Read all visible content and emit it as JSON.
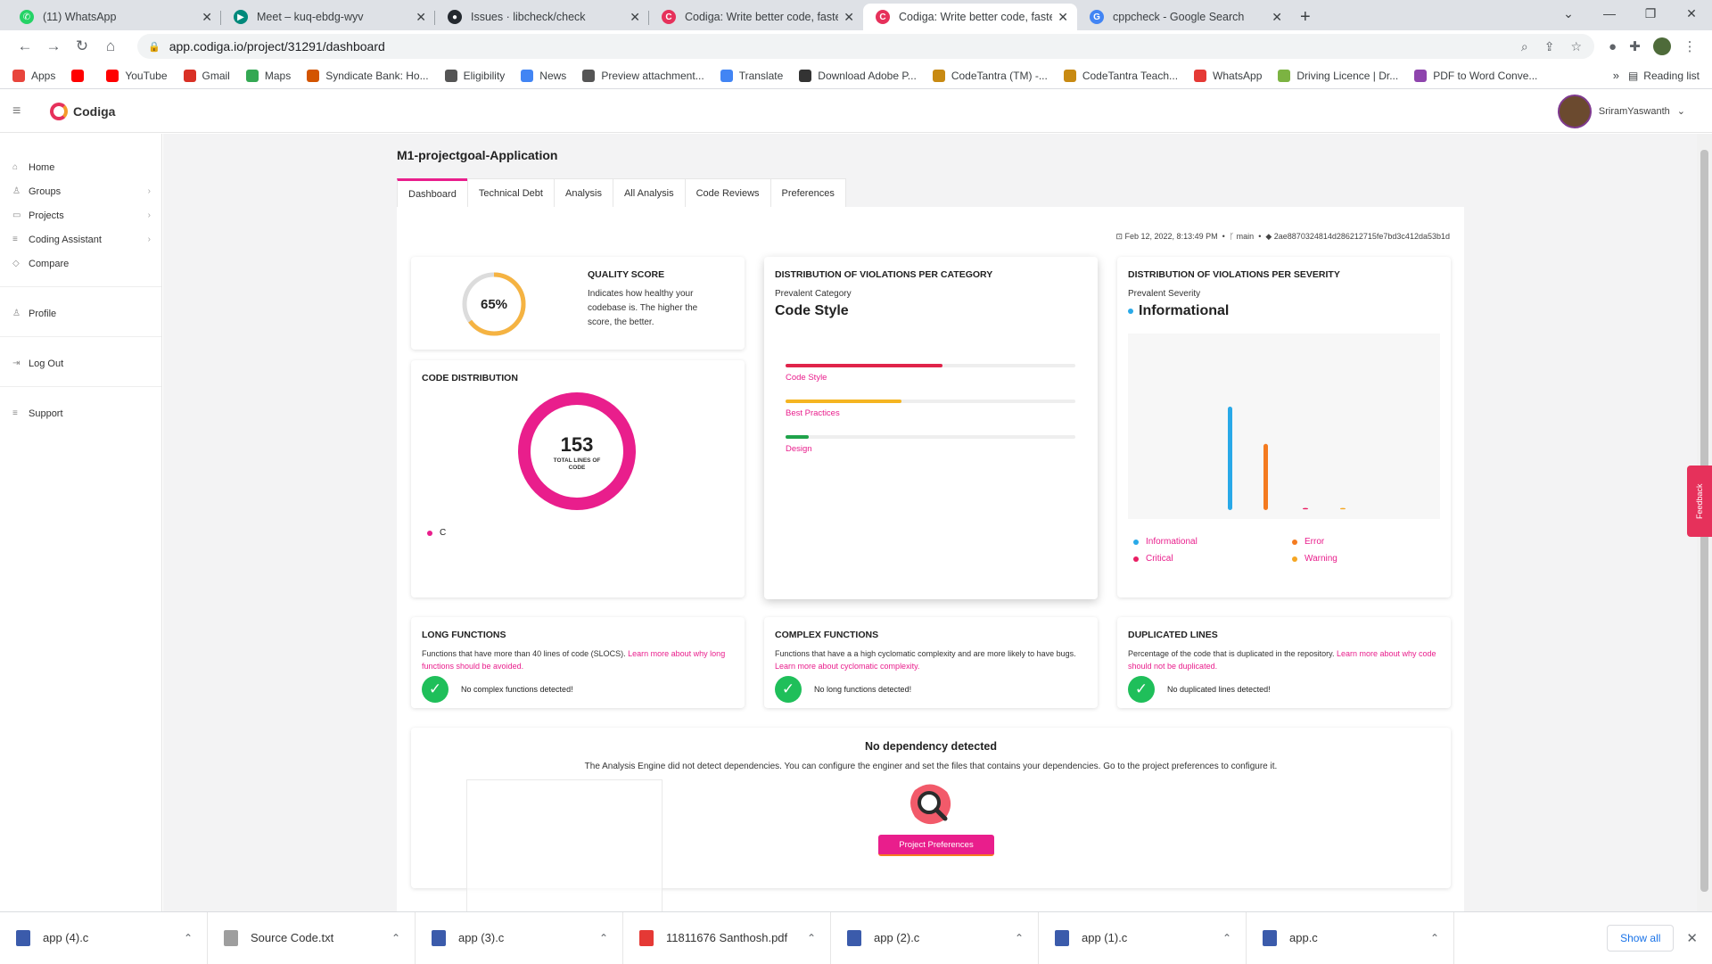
{
  "browser": {
    "tabs": [
      {
        "title": "(11) WhatsApp",
        "color": "#25d366",
        "glyph": "✆"
      },
      {
        "title": "Meet – kuq-ebdg-wyv",
        "color": "#00897b",
        "glyph": "▶"
      },
      {
        "title": "Issues · libcheck/check",
        "color": "#24292f",
        "glyph": "●"
      },
      {
        "title": "Codiga: Write better code, faster!",
        "color": "#e6315b",
        "glyph": "C"
      },
      {
        "title": "Codiga: Write better code, faster!",
        "color": "#e6315b",
        "glyph": "C",
        "active": true
      },
      {
        "title": "cppcheck - Google Search",
        "color": "#4285f4",
        "glyph": "G"
      }
    ],
    "url": "app.codiga.io/project/31291/dashboard",
    "bookmarks": [
      {
        "label": "Apps",
        "color": "#e8453c"
      },
      {
        "label": "",
        "color": "#ff0000"
      },
      {
        "label": "YouTube",
        "color": "#ff0000"
      },
      {
        "label": "Gmail",
        "color": "#d93025"
      },
      {
        "label": "Maps",
        "color": "#34a853"
      },
      {
        "label": "Syndicate Bank: Ho...",
        "color": "#d35400"
      },
      {
        "label": "Eligibility",
        "color": "#555555"
      },
      {
        "label": "News",
        "color": "#4285f4"
      },
      {
        "label": "Preview attachment...",
        "color": "#555555"
      },
      {
        "label": "Translate",
        "color": "#4285f4"
      },
      {
        "label": "Download Adobe P...",
        "color": "#333333"
      },
      {
        "label": "CodeTantra (TM) -...",
        "color": "#c88a12"
      },
      {
        "label": "CodeTantra Teach...",
        "color": "#c88a12"
      },
      {
        "label": "WhatsApp",
        "color": "#e53935"
      },
      {
        "label": "Driving Licence | Dr...",
        "color": "#7cb342"
      },
      {
        "label": "PDF to Word Conve...",
        "color": "#8e44ad"
      }
    ],
    "reading_list": "Reading list"
  },
  "app": {
    "brand": "Codiga",
    "user": "SriramYaswanth",
    "sidebar": {
      "main": [
        {
          "label": "Home",
          "icon": "home-icon",
          "glyph": "⌂"
        },
        {
          "label": "Groups",
          "icon": "groups-icon",
          "glyph": "♙",
          "chevron": true
        },
        {
          "label": "Projects",
          "icon": "projects-icon",
          "glyph": "▭",
          "chevron": true
        },
        {
          "label": "Coding Assistant",
          "icon": "assistant-icon",
          "glyph": "≡",
          "chevron": true
        },
        {
          "label": "Compare",
          "icon": "compare-icon",
          "glyph": "◇"
        }
      ],
      "profile": "Profile",
      "logout": "Log Out",
      "support": "Support"
    },
    "project_title": "M1-projectgoal-Application",
    "tabs": [
      "Dashboard",
      "Technical Debt",
      "Analysis",
      "All Analysis",
      "Code Reviews",
      "Preferences"
    ],
    "meta": {
      "date": "Feb 12, 2022, 8:13:49 PM",
      "branch": "main",
      "commit": "2ae8870324814d286212715fe7bd3c412da53b1d"
    },
    "quality": {
      "title": "QUALITY SCORE",
      "score_label": "65%",
      "score": 0.65,
      "desc": "Indicates how healthy your codebase is. The higher the score, the better."
    },
    "code_distribution": {
      "title": "CODE DISTRIBUTION",
      "total": "153",
      "total_label": "TOTAL LINES OF CODE",
      "legend": "C"
    },
    "category": {
      "title": "DISTRIBUTION OF VIOLATIONS PER CATEGORY",
      "prevalent_label": "Prevalent Category",
      "prevalent": "Code Style",
      "bars": [
        {
          "label": "Code Style",
          "value": 0.54,
          "color": "#e0234a"
        },
        {
          "label": "Best Practices",
          "value": 0.4,
          "color": "#f5b521"
        },
        {
          "label": "Design",
          "value": 0.08,
          "color": "#1fa34a"
        }
      ]
    },
    "severity": {
      "title": "DISTRIBUTION OF VIOLATIONS PER SEVERITY",
      "prevalent_label": "Prevalent Severity",
      "prevalent": "Informational",
      "bars": [
        {
          "label": "Informational",
          "value": 1.0,
          "color": "#29a9e8"
        },
        {
          "label": "Error",
          "value": 0.64,
          "color": "#f47b20"
        },
        {
          "label": "Critical",
          "value": 0.02,
          "color": "#e91e63"
        },
        {
          "label": "Warning",
          "value": 0.02,
          "color": "#f5a623"
        }
      ]
    },
    "long_functions": {
      "title": "LONG FUNCTIONS",
      "desc": "Functions that have more than 40 lines of code (SLOCS). ",
      "link": "Learn more about why long functions should be avoided.",
      "status": "No complex functions detected!"
    },
    "complex_functions": {
      "title": "COMPLEX FUNCTIONS",
      "desc": "Functions that have a a high cyclomatic complexity and are more likely to have bugs. ",
      "link": "Learn more about cyclomatic complexity.",
      "status": "No long functions detected!"
    },
    "duplicated_lines": {
      "title": "DUPLICATED LINES",
      "desc": "Percentage of the code that is duplicated in the repository. ",
      "link": "Learn more about why code should not be duplicated.",
      "status": "No duplicated lines detected!"
    },
    "dependency": {
      "title": "No dependency detected",
      "desc": "The Analysis Engine did not detect dependencies. You can configure the enginer and set the files that contains your dependencies. Go to the project preferences to configure it.",
      "button": "Project Preferences"
    },
    "feedback": "Feedback"
  },
  "downloads": {
    "items": [
      {
        "name": "app (4).c",
        "color": "#3b5bab"
      },
      {
        "name": "Source Code.txt",
        "color": "#9e9e9e"
      },
      {
        "name": "app (3).c",
        "color": "#3b5bab"
      },
      {
        "name": "11811676 Santhosh.pdf",
        "color": "#e53935"
      },
      {
        "name": "app (2).c",
        "color": "#3b5bab"
      },
      {
        "name": "app (1).c",
        "color": "#3b5bab"
      },
      {
        "name": "app.c",
        "color": "#3b5bab"
      }
    ],
    "show_all": "Show all"
  }
}
